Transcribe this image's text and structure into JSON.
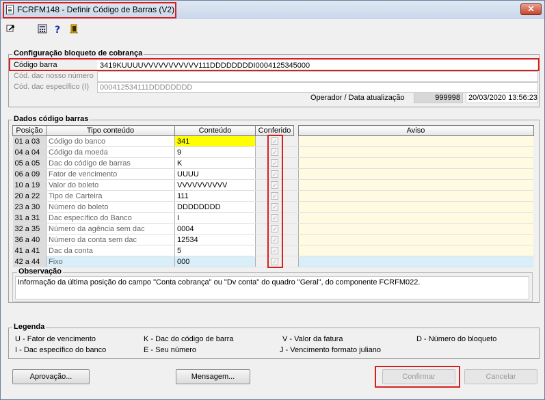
{
  "window": {
    "title": "FCRFM148 - Definir Código de Barras (V2)",
    "close_label": "✕"
  },
  "toolbar": {
    "icons": [
      "export-icon",
      "calculator-icon",
      "help-icon",
      "exit-icon"
    ]
  },
  "config": {
    "group_title": "Configuração bloqueto de cobrança",
    "codigo_barra_label": "Código barra",
    "codigo_barra_value": "3419KUUUUVVVVVVVVVVV111DDDDDDDDI0004125345000",
    "nosso_numero_label": "Cód. dac nosso número",
    "nosso_numero_value": "",
    "especifico_label": "Cód. dac específico (I)",
    "especifico_value": "000412534111DDDDDDDD",
    "operador_label": "Operador / Data atualização",
    "operador_value": "999998",
    "data_value": "20/03/2020 13:56:23"
  },
  "grid": {
    "group_title": "Dados código barras",
    "headers": {
      "posicao": "Posição",
      "tipo": "Tipo conteúdo",
      "conteudo": "Conteúdo",
      "conferido": "Conferido",
      "aviso": "Aviso"
    },
    "rows": [
      {
        "posicao": "01 a 03",
        "tipo": "Código do banco",
        "conteudo": "341"
      },
      {
        "posicao": "04 a 04",
        "tipo": "Código da moeda",
        "conteudo": "9"
      },
      {
        "posicao": "05 a 05",
        "tipo": "Dac do código de barras",
        "conteudo": "K"
      },
      {
        "posicao": "06 a 09",
        "tipo": "Fator de vencimento",
        "conteudo": "UUUU"
      },
      {
        "posicao": "10 a 19",
        "tipo": "Valor do boleto",
        "conteudo": "VVVVVVVVVV"
      },
      {
        "posicao": "20 a 22",
        "tipo": "Tipo de Carteira",
        "conteudo": "111"
      },
      {
        "posicao": "23 a 30",
        "tipo": "Número do boleto",
        "conteudo": "DDDDDDDD"
      },
      {
        "posicao": "31 a 31",
        "tipo": "Dac específico do Banco",
        "conteudo": "I"
      },
      {
        "posicao": "32 a 35",
        "tipo": "Número da agência sem dac",
        "conteudo": "0004"
      },
      {
        "posicao": "36 a 40",
        "tipo": "Número da conta sem dac",
        "conteudo": "12534"
      },
      {
        "posicao": "41 a 41",
        "tipo": "Dac da conta",
        "conteudo": "5"
      },
      {
        "posicao": "42 a 44",
        "tipo": "Fixo",
        "conteudo": "000"
      }
    ]
  },
  "observacao": {
    "title": "Observação",
    "text": "Informação da última posição do campo \"Conta cobrança\" ou \"Dv conta\" do quadro \"Geral\", do componente FCRFM022."
  },
  "legenda": {
    "title": "Legenda",
    "items": [
      "U - Fator de vencimento",
      "K - Dac do código de barra",
      "V - Valor da fatura",
      "D - Número do bloqueto",
      "I - Dac específico do banco",
      "E - Seu número",
      "J - Vencimento formato juliano"
    ]
  },
  "buttons": {
    "aprovacao": "Aprovação...",
    "mensagem": "Mensagem...",
    "confirmar": "Confirmar",
    "cancelar": "Cancelar"
  },
  "colors": {
    "highlight": "#d62020",
    "yellow_cell": "#ffff00",
    "aviso_bg": "#fffbe2",
    "fixo_row": "#d8eef9"
  }
}
